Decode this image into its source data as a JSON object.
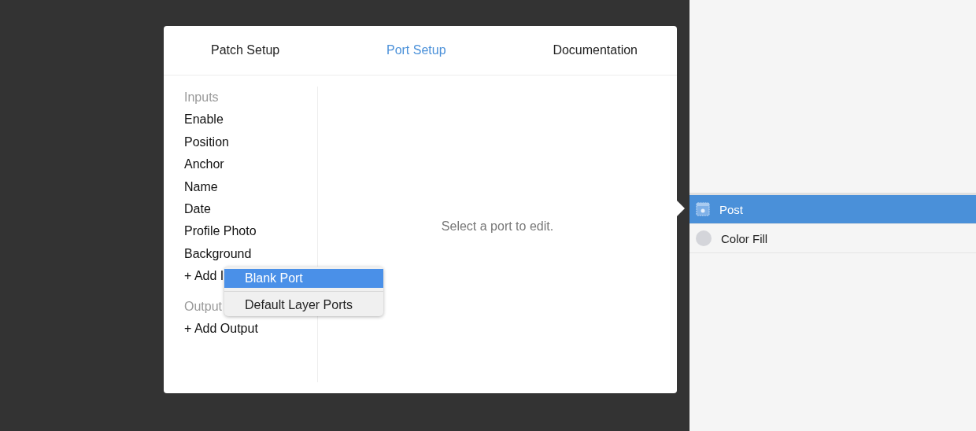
{
  "popover": {
    "tabs": [
      {
        "label": "Patch Setup",
        "selected": false
      },
      {
        "label": "Port Setup",
        "selected": true
      },
      {
        "label": "Documentation",
        "selected": false
      }
    ],
    "inputs": {
      "header": "Inputs",
      "ports": [
        "Enable",
        "Position",
        "Anchor",
        "Name",
        "Date",
        "Profile Photo",
        "Background"
      ],
      "add": "+ Add I"
    },
    "outputs": {
      "header": "Output",
      "add": "+ Add Output"
    },
    "detail_hint": "Select a port to edit.",
    "menu": [
      {
        "label": "Blank Port",
        "selected": true
      },
      {
        "label": "Default Layer Ports",
        "selected": false
      }
    ]
  },
  "layers": [
    {
      "name": "Post",
      "kind": "group",
      "selected": true
    },
    {
      "name": "Color Fill",
      "kind": "fill",
      "selected": false
    }
  ]
}
